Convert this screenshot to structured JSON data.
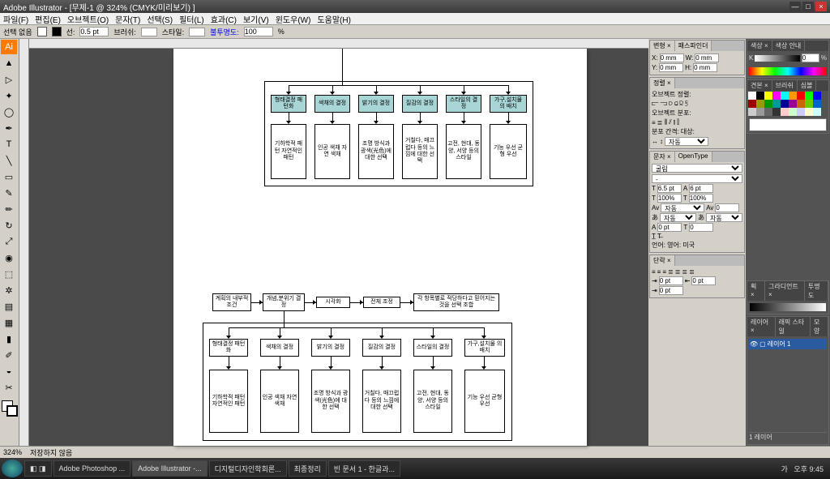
{
  "title": "Adobe Illustrator - [무제-1 @ 324% (CMYK/미리보기) ]",
  "menu": [
    "파일(F)",
    "편집(E)",
    "오브젝트(O)",
    "문자(T)",
    "선택(S)",
    "필터(L)",
    "효과(C)",
    "보기(V)",
    "윈도우(W)",
    "도움말(H)"
  ],
  "ctrl": {
    "noSel": "선택 없음",
    "stroke": "선:",
    "strokeW": "0.5 pt",
    "brush": "브러쉬:",
    "style": "스타일:",
    "opacity": "불투명도:",
    "opVal": "100",
    "pct": "%"
  },
  "diagram1": {
    "row1": [
      "형태결정 패턴화",
      "색채의 결정",
      "밝기의 결정",
      "질감의 결정",
      "스타일의 결정",
      "가구,설치물 의 배치"
    ],
    "row2": [
      "기하학적 패턴 자연적인 패턴",
      "인공 색채 자연 색채",
      "조명 방식과 광색(光色)에 대한 선택",
      "거칠다, 매끄럽다 등의 느낌에 대한 선택",
      "고전, 현대, 동양, 서양 등의 스타일",
      "기능 우선 균형 우선"
    ]
  },
  "diagram2": {
    "top": [
      "계획의 내부적 조건",
      "개념,분위기 결정",
      "시각화",
      "전체 조정",
      "각 항목별로 적당하다고 믿어지는 것을 선택 조합"
    ],
    "row1": [
      "형태결정 패턴화",
      "색채의 결정",
      "밝기의 결정",
      "질감의 결정",
      "스타일의 결정",
      "가구,설치물 의 배치"
    ],
    "row2": [
      "기하학적 패턴 자연적인 패턴",
      "인공 색채 자연 색채",
      "조명 방식과 광색(光色)에 대한 선택",
      "거칠다, 매끄럽다 등의 느낌에 대한 선택",
      "고전, 현대, 동양, 서양 등의 스타일",
      "기능 우선 균형 우선"
    ]
  },
  "panels": {
    "transform": {
      "tab": "변형 ×",
      "tab2": "패스파인더",
      "x": "X:",
      "y": "Y:",
      "w": "W:",
      "h": "H:",
      "xv": "0 mm",
      "yv": "0 mm",
      "wv": "0 mm",
      "hv": "0 mm"
    },
    "align": {
      "tab": "정렬 ×",
      "objAlign": "오브젝트 정렬:",
      "objDist": "오브젝트 분포:",
      "distGap": "분포 간격:",
      "to": "대상:",
      "auto": "자동"
    },
    "char": {
      "tab": "문자 ×",
      "tab2": "OpenType",
      "font": "굴림",
      "sz": "6.5 pt",
      "lead": "6 pt",
      "track": "자동",
      "kern": "0",
      "hs": "100%",
      "vs": "100%",
      "baseline": "0 pt",
      "rot": "0",
      "lang": "언어: 영어: 미국"
    },
    "para": {
      "tab": "단락 ×",
      "li": "0 pt",
      "ri": "0 pt",
      "fi": "0 pt"
    },
    "color": {
      "tab": "색상 ×",
      "tab2": "색상 안내",
      "k": "K",
      "kv": "0",
      "pct": "%"
    },
    "swatch": {
      "tab": "견본 ×",
      "tab2": "브러쉬",
      "tab3": "심볼"
    },
    "grad": {
      "tab": "획 ×",
      "tab2": "그라디언트 ×",
      "tab3": "투명도"
    },
    "layers": {
      "tab": "레이어 ×",
      "tab2": "래픽 스타일",
      "tab3": "모양",
      "name": "레이어 1",
      "count": "1 레이어"
    }
  },
  "status": {
    "zoom": "324%",
    "save": "저장하지 않음"
  },
  "taskbar": {
    "items": [
      "Adobe Photoshop ...",
      "Adobe Illustrator -...",
      "디지털디자인학회론...",
      "최종정리",
      "빈 문서 1 - 한글과..."
    ],
    "time": "오후 9:45",
    "tray": "가"
  }
}
